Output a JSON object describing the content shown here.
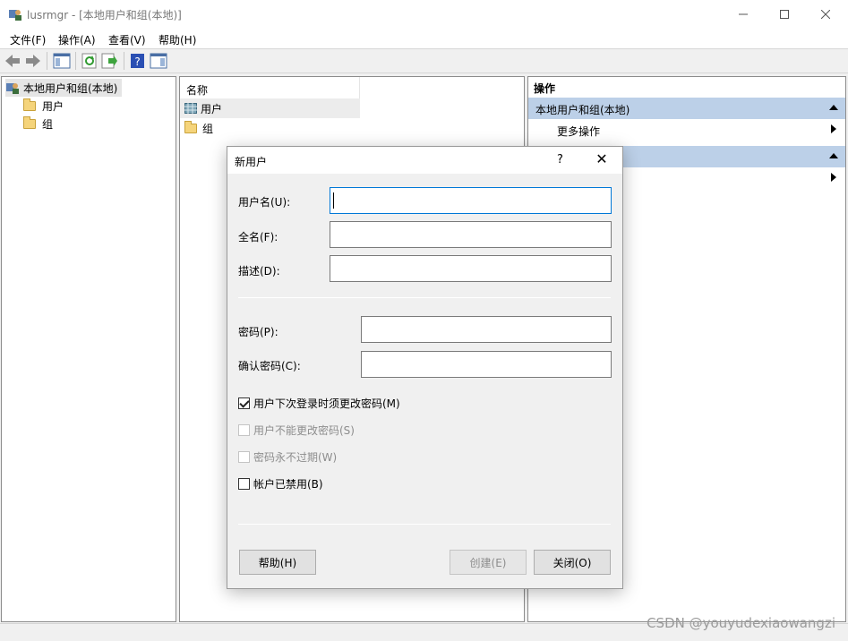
{
  "window": {
    "title": "lusrmgr - [本地用户和组(本地)]",
    "minimize_icon": "minimize-icon",
    "maximize_icon": "maximize-icon",
    "close_icon": "close-icon"
  },
  "menu": [
    "文件(F)",
    "操作(A)",
    "查看(V)",
    "帮助(H)"
  ],
  "toolbar": {
    "icons": [
      "back-icon",
      "forward-icon",
      "show-hide-tree-icon",
      "refresh-icon",
      "export-list-icon",
      "help-icon",
      "show-hide-action-pane-icon"
    ]
  },
  "tree": {
    "root": "本地用户和组(本地)",
    "children": [
      "用户",
      "组"
    ]
  },
  "list": {
    "column_header": "名称",
    "items": [
      "用户",
      "组"
    ]
  },
  "actions": {
    "header": "操作",
    "section1": "本地用户和组(本地)",
    "section1_item": "更多操作"
  },
  "dialog": {
    "title": "新用户",
    "help_label": "?",
    "close_label": "✕",
    "fields": {
      "username_label": "用户名(U):",
      "username_value": "",
      "fullname_label": "全名(F):",
      "fullname_value": "",
      "description_label": "描述(D):",
      "description_value": "",
      "password_label": "密码(P):",
      "password_value": "",
      "confirm_label": "确认密码(C):",
      "confirm_value": ""
    },
    "checkboxes": {
      "must_change": {
        "label": "用户下次登录时须更改密码(M)",
        "checked": true,
        "enabled": true
      },
      "cannot_change": {
        "label": "用户不能更改密码(S)",
        "checked": false,
        "enabled": false
      },
      "never_expires": {
        "label": "密码永不过期(W)",
        "checked": false,
        "enabled": false
      },
      "disabled": {
        "label": "帐户已禁用(B)",
        "checked": false,
        "enabled": true
      }
    },
    "buttons": {
      "help": "帮助(H)",
      "create": "创建(E)",
      "close": "关闭(O)"
    }
  },
  "watermark": "CSDN @youyudexiaowangzi",
  "colors": {
    "section_bg": "#bcd0e8",
    "focus_border": "#0078d7"
  }
}
